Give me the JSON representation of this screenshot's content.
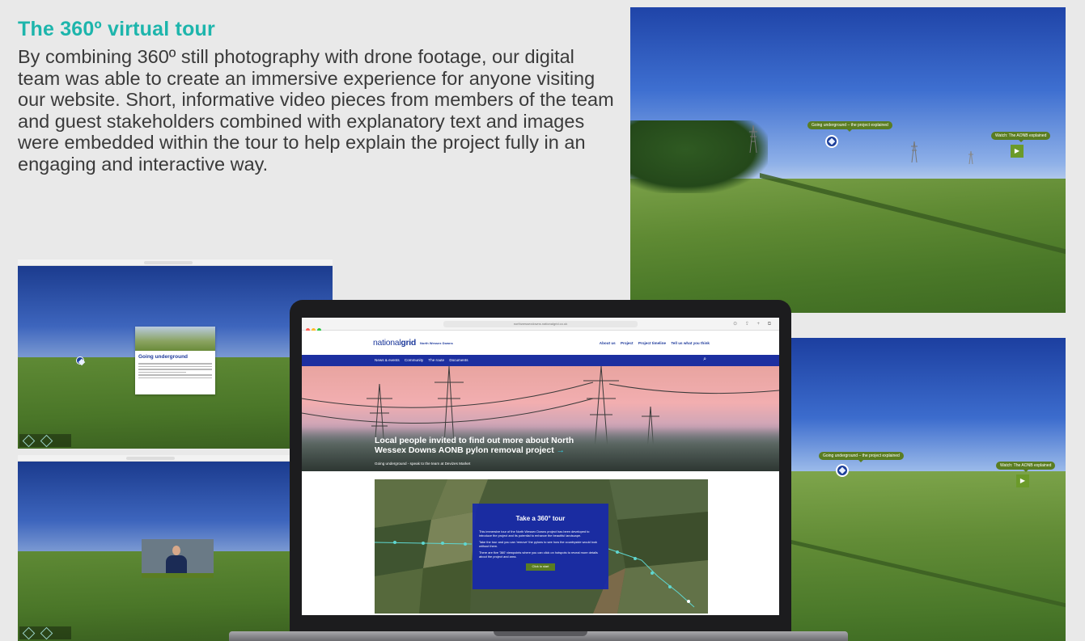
{
  "intro": {
    "title": "The 360º virtual tour",
    "body": "By combining 360º still photography with drone footage, our digital team was able to create an immersive experience for anyone visiting our website. Short, informative video pieces from members of the team and guest stakeholders combined with explanatory text and images were embedded within the tour to help explain the project fully in an engaging and interactive way."
  },
  "panorama_top": {
    "hotspot_underground": "Going underground – the project explained",
    "hotspot_aonb": "Watch: The AONB explained"
  },
  "panorama_bottom": {
    "hotspot_underground": "Going underground – the project explained",
    "hotspot_aonb": "Watch: The AONB explained"
  },
  "mini_browser_1": {
    "card_title": "Going underground"
  },
  "laptop": {
    "url": "northwessexdowns.nationalgrid.co.uk",
    "logo_light": "national",
    "logo_bold": "grid",
    "logo_sub": "North Wessex Downs",
    "top_links": [
      "About us",
      "Project",
      "Project timeline",
      "Tell us what you think"
    ],
    "nav_items": [
      "News & events",
      "Community",
      "The route",
      "Documents"
    ],
    "hero_title": "Local people invited to find out more about North Wessex Downs AONB pylon removal project",
    "hero_arrow": "→",
    "hero_sub": "Going underground - speak to the team at Devizes Market",
    "tour": {
      "title": "Take a 360° tour",
      "p1": "This immersive tour of the North Wessex Downs project has been developed to introduce the project and its potential to enhance the beautiful landscape.",
      "p2": "Take the tour and you can 'remove' the pylons to see how the countryside would look without them.",
      "p3": "There are five '360' viewpoints where you can click on hotspots to reveal more details about the project and area.",
      "cta": "Click to start"
    }
  },
  "colors": {
    "accent_teal": "#1db5ac",
    "brand_blue": "#1c2fa0",
    "hotspot_green": "#5a7d22"
  }
}
